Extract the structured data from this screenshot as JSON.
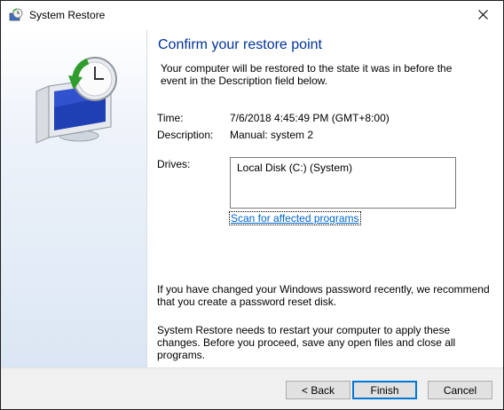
{
  "window": {
    "title": "System Restore"
  },
  "header": {
    "heading": "Confirm your restore point",
    "intro": "Your computer will be restored to the state it was in before the event in the Description field below."
  },
  "details": {
    "time_label": "Time:",
    "time_value": "7/6/2018 4:45:49 PM (GMT+8:00)",
    "description_label": "Description:",
    "description_value": "Manual: system 2",
    "drives_label": "Drives:",
    "drives": [
      "Local Disk (C:) (System)"
    ],
    "scan_link": "Scan for affected programs"
  },
  "notes": {
    "password_note": "If you have changed your Windows password recently, we recommend that you create a password reset disk.",
    "restart_note": "System Restore needs to restart your computer to apply these changes. Before you proceed, save any open files and close all programs."
  },
  "buttons": {
    "back": "< Back",
    "finish": "Finish",
    "cancel": "Cancel"
  },
  "colors": {
    "heading": "#003399",
    "link": "#0066cc",
    "primary_border": "#0078d7"
  },
  "icons": {
    "title": "system-restore-icon",
    "hero": "system-restore-clock-monitor-icon",
    "close": "close-icon"
  }
}
